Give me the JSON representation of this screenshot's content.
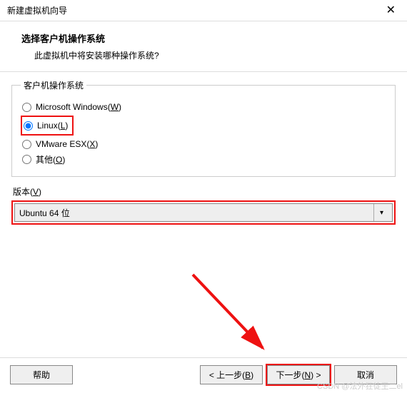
{
  "window": {
    "title": "新建虚拟机向导",
    "close_label": "✕"
  },
  "header": {
    "title": "选择客户机操作系统",
    "subtitle": "此虚拟机中将安装哪种操作系统?"
  },
  "os_group": {
    "legend": "客户机操作系统",
    "options": {
      "windows": {
        "prefix": "Microsoft Windows(",
        "u": "W",
        "suffix": ")"
      },
      "linux": {
        "prefix": "Linux(",
        "u": "L",
        "suffix": ")"
      },
      "esx": {
        "prefix": "VMware ESX(",
        "u": "X",
        "suffix": ")"
      },
      "other": {
        "prefix": "其他(",
        "u": "O",
        "suffix": ")"
      }
    },
    "selected": "linux"
  },
  "version": {
    "label_prefix": "版本(",
    "label_u": "V",
    "label_suffix": ")",
    "selected": "Ubuntu 64 位"
  },
  "buttons": {
    "help": "帮助",
    "back_prefix": "< 上一步(",
    "back_u": "B",
    "back_suffix": ")",
    "next_prefix": "下一步(",
    "next_u": "N",
    "next_suffix": ") >",
    "cancel": "取消"
  },
  "watermark": "CSDN @法外狂徒王二el"
}
